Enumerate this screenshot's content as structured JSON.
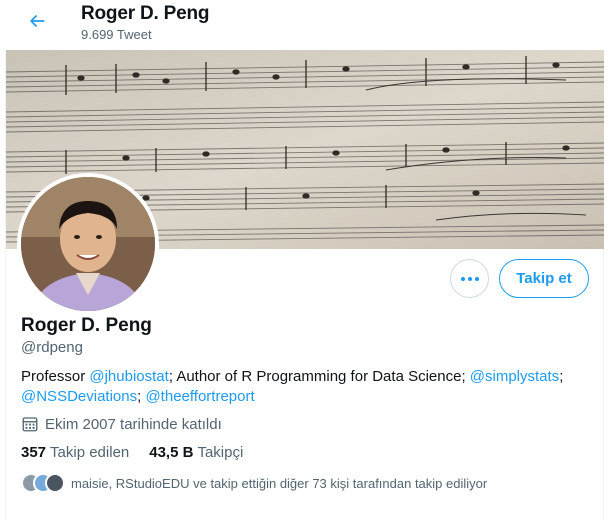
{
  "header": {
    "name": "Roger D. Peng",
    "tweet_count": "9.699 Tweet"
  },
  "profile": {
    "display_name": "Roger D. Peng",
    "handle": "@rdpeng",
    "bio": {
      "part1": "Professor ",
      "link1": "@jhubiostat",
      "part2": "; Author of R Programming for Data Science; ",
      "link2": "@simplystats",
      "part3": "; ",
      "link3": "@NSSDeviations",
      "part4": "; ",
      "link4": "@theeffortreport"
    },
    "joined": "Ekim 2007 tarihinde katıldı",
    "following_count": "357",
    "following_label": "Takip edilen",
    "followers_count": "43,5 B",
    "followers_label": "Takipçi",
    "followed_by_text": "maisie, RStudioEDU ve takip ettiğin diğer 73 kişi tarafından takip ediliyor"
  },
  "actions": {
    "follow_label": "Takip et"
  },
  "colors": {
    "accent": "#1d9bf0",
    "text": "#0f1419",
    "secondary": "#536471"
  }
}
